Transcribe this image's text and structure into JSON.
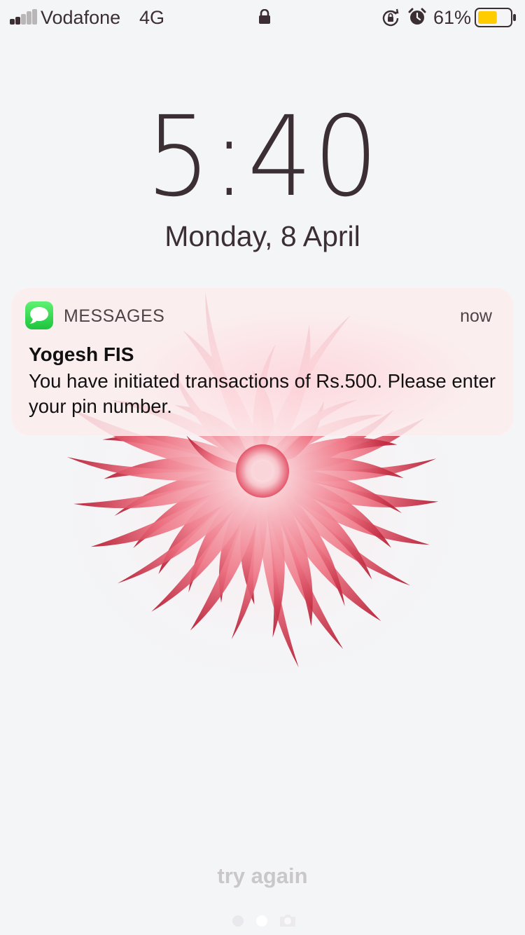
{
  "status_bar": {
    "carrier": "Vodafone",
    "network": "4G",
    "signal_bars": 5,
    "signal_bars_active": 2,
    "icons": [
      "lock-icon",
      "rotation-lock-icon",
      "alarm-icon",
      "battery-icon"
    ],
    "battery_percent": "61%",
    "battery_level": 0.61,
    "battery_color": "#ffcc00"
  },
  "lock_screen": {
    "time": "5:40",
    "date": "Monday, 8 April"
  },
  "notification": {
    "app_name": "MESSAGES",
    "app_icon": "messages-icon",
    "app_icon_color": "#34c759",
    "time": "now",
    "title": "Yogesh FIS",
    "body": "You have initiated transactions of Rs.500. Please enter your pin number."
  },
  "footer": {
    "hint": "try again",
    "page_indicators": [
      "dot",
      "dot-active",
      "camera-icon"
    ]
  },
  "wallpaper": {
    "subject": "flower",
    "accent": "#e23a4c",
    "background": "#f4f5f7"
  }
}
